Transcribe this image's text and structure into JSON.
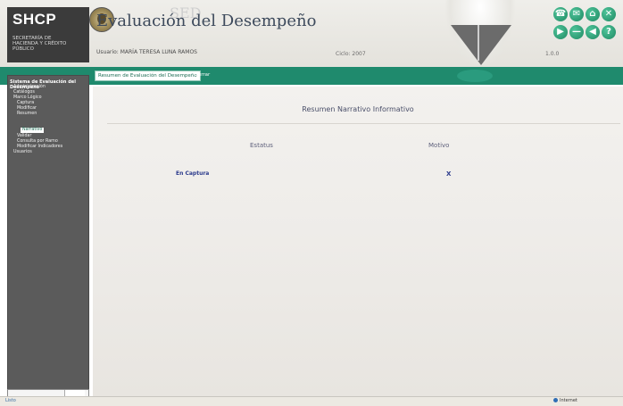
{
  "header": {
    "brand": "SHCP",
    "brand_sub": "SECRETARÍA DE HACIENDA Y CRÉDITO PÚBLICO",
    "title": "Evaluación del Desempeño",
    "watermark": "SED",
    "user": "Usuario: MARÍA TERESA LUNA RAMOS",
    "year": "Ciclo: 2007",
    "page_code": "1.0.0",
    "toolbar_icons": [
      {
        "name": "phone-icon",
        "glyph": "☎"
      },
      {
        "name": "mail-icon",
        "glyph": "✉"
      },
      {
        "name": "home-icon",
        "glyph": "⌂"
      },
      {
        "name": "close-icon",
        "glyph": "✕"
      },
      {
        "name": "forward-icon",
        "glyph": "▶"
      },
      {
        "name": "minus-icon",
        "glyph": "—"
      },
      {
        "name": "back-icon",
        "glyph": "◀"
      },
      {
        "name": "help-icon",
        "glyph": "?"
      }
    ]
  },
  "tabbar": {
    "active_tab": "Resumen de Evaluación del Desempeño",
    "close_label": "Cerrar"
  },
  "sidebar": {
    "title": "Sistema de Evaluación del Desempeño",
    "items": [
      {
        "label": "Administración",
        "level": 1
      },
      {
        "label": "Catálogos",
        "level": 1
      },
      {
        "label": "Marco Lógico",
        "level": 1
      },
      {
        "label": "Captura",
        "level": 2
      },
      {
        "label": "Modificar",
        "level": 2
      },
      {
        "label": "Resumen",
        "level": 2
      },
      {
        "label": "Narrativo",
        "level": 3,
        "selected": true
      },
      {
        "label": "Validar",
        "level": 2
      },
      {
        "label": "Consulta por Ramo",
        "level": 2
      },
      {
        "label": "Modificar Indicadores",
        "level": 2
      },
      {
        "label": "Usuarios",
        "level": 1
      }
    ]
  },
  "main": {
    "title": "Resumen Narrativo Informativo",
    "columns": [
      "Estatus",
      "Motivo"
    ],
    "rows": [
      {
        "estatus": "En Captura",
        "motivo": "X"
      }
    ]
  },
  "statusbar": {
    "left": "Listo",
    "right": "Internet"
  }
}
